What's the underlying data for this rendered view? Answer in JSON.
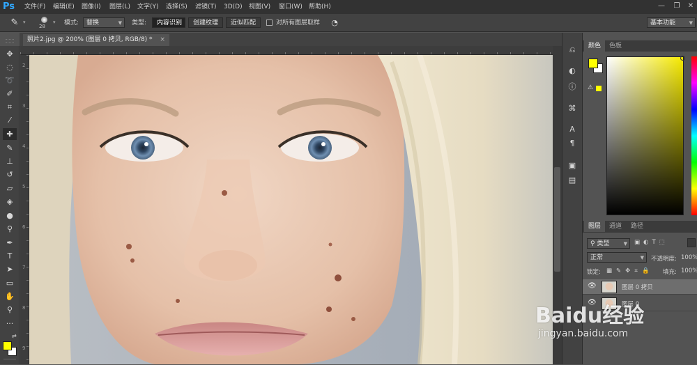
{
  "app": {
    "logo": "Ps"
  },
  "menu": [
    "文件(F)",
    "编辑(E)",
    "图像(I)",
    "图层(L)",
    "文字(Y)",
    "选择(S)",
    "滤镜(T)",
    "3D(D)",
    "视图(V)",
    "窗口(W)",
    "帮助(H)"
  ],
  "window_controls": {
    "minimize": "—",
    "restore": "❐",
    "close": "✕"
  },
  "options": {
    "brush_size": "28",
    "mode_label": "模式:",
    "mode_value": "替换",
    "type_label": "类型:",
    "type_buttons": [
      "内容识别",
      "创建纹理",
      "近似匹配"
    ],
    "sample_all_label": "对所有图层取样",
    "workspace_value": "基本功能"
  },
  "document": {
    "tab_title": "照片2.jpg @ 200% (图层 0 拷贝, RGB/8) *",
    "close": "×",
    "ruler_marks_v": [
      "2",
      "3",
      "4",
      "5",
      "6",
      "7",
      "8",
      "9"
    ]
  },
  "color_panel": {
    "tabs": [
      "颜色",
      "色板"
    ],
    "foreground": "#ffff00",
    "background": "#ffffff"
  },
  "layers_panel": {
    "tabs": [
      "图层",
      "通道",
      "路径"
    ],
    "filter_kind": "类型",
    "blend_mode": "正常",
    "opacity_label": "不透明度:",
    "opacity_value": "100%",
    "lock_label": "锁定:",
    "fill_label": "填充:",
    "fill_value": "100%",
    "layers": [
      {
        "name": "图层 0 拷贝",
        "selected": true
      },
      {
        "name": "图层 0",
        "selected": false
      }
    ]
  },
  "watermark": {
    "brand": "Baidu经验",
    "url": "jingyan.baidu.com"
  },
  "icons": {
    "toolbar": [
      "move-icon",
      "marquee-icon",
      "lasso-icon",
      "quick-select-icon",
      "crop-icon",
      "eyedropper-icon",
      "healing-brush-icon",
      "brush-icon",
      "clone-stamp-icon",
      "history-brush-icon",
      "eraser-icon",
      "paint-bucket-icon",
      "blur-icon",
      "dodge-icon",
      "pen-icon",
      "type-icon",
      "path-select-icon",
      "rectangle-icon",
      "hand-icon",
      "zoom-icon",
      "more-tools-icon"
    ]
  }
}
